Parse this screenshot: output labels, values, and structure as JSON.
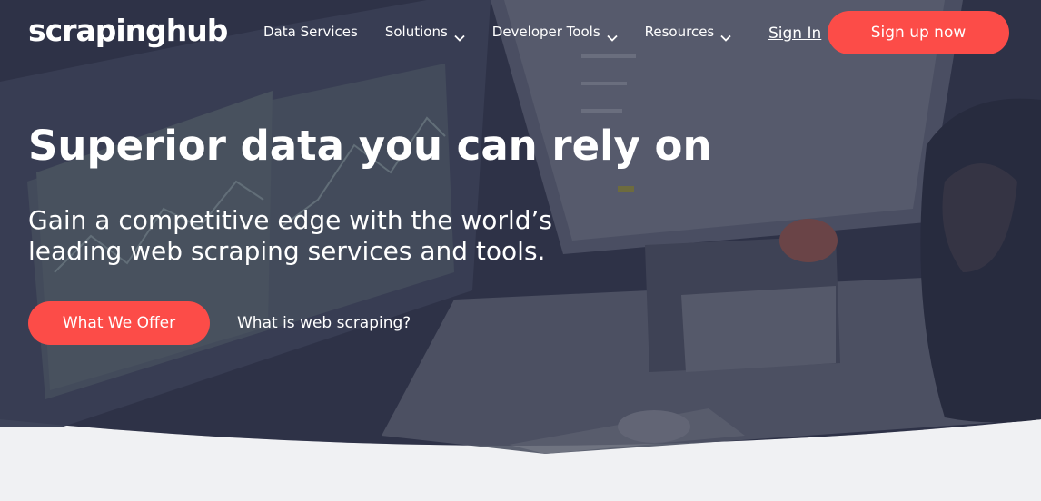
{
  "brand": {
    "logo_text": "scrapinghub"
  },
  "nav": {
    "items": [
      {
        "label": "Data Services",
        "has_dropdown": false
      },
      {
        "label": "Solutions",
        "has_dropdown": true
      },
      {
        "label": "Developer Tools",
        "has_dropdown": true
      },
      {
        "label": "Resources",
        "has_dropdown": true
      }
    ],
    "sign_in": "Sign In",
    "sign_up": "Sign up now"
  },
  "hero": {
    "headline": "Superior data you can rely on",
    "subheadline": "Gain a competitive edge with the world’s leading web scraping services and tools.",
    "primary_cta": "What We Offer",
    "secondary_link": "What is web scraping?"
  },
  "colors": {
    "accent": "#fc4c48",
    "hero_overlay": "#2d3148",
    "page_background": "#f0f1f3"
  }
}
